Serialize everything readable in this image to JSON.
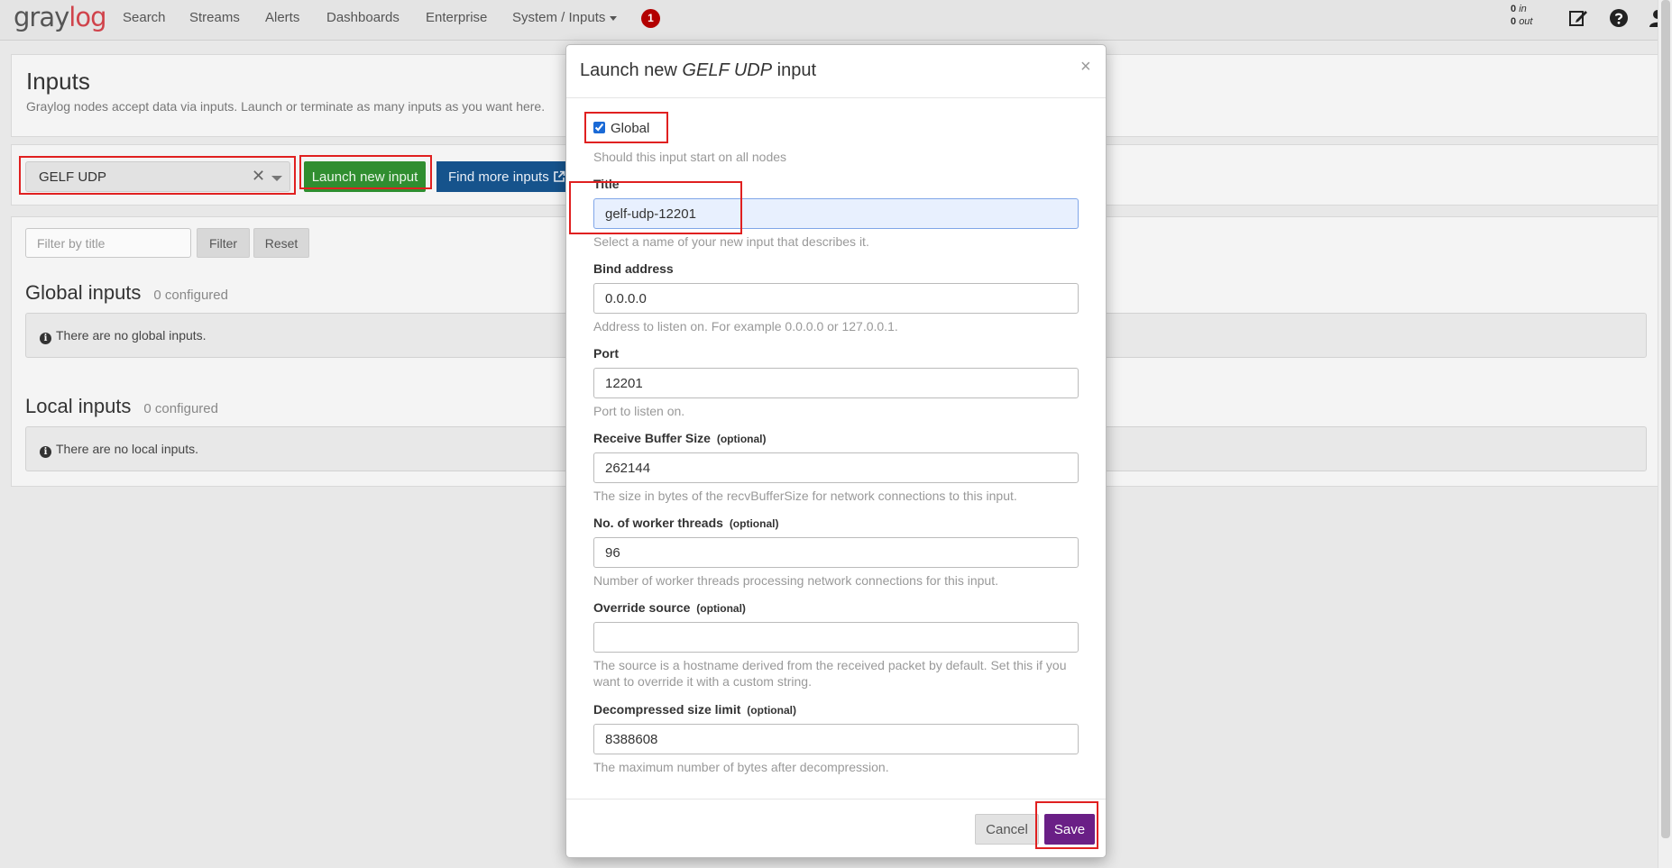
{
  "nav": {
    "logo_a": "gray",
    "logo_b": "log",
    "items": [
      "Search",
      "Streams",
      "Alerts",
      "Dashboards",
      "Enterprise",
      "System / Inputs"
    ],
    "notification_count": "1",
    "throughput_in_value": "0",
    "throughput_in_label": "in",
    "throughput_out_value": "0",
    "throughput_out_label": "out",
    "icons": [
      "edit-icon",
      "help-icon",
      "user-icon"
    ]
  },
  "page": {
    "title": "Inputs",
    "description": "Graylog nodes accept data via inputs. Launch or terminate as many inputs as you want here.",
    "input_type_value": "GELF UDP",
    "clear_glyph": "✕",
    "launch_button": "Launch new input",
    "find_more_button": "Find more inputs",
    "filter_placeholder": "Filter by title",
    "filter_button": "Filter",
    "reset_button": "Reset",
    "global_heading": "Global inputs",
    "global_count": "0 configured",
    "global_empty": "There are no global inputs.",
    "local_heading": "Local inputs",
    "local_count": "0 configured",
    "local_empty": "There are no local inputs.",
    "info_glyph": "i"
  },
  "modal": {
    "title_prefix": "Launch new ",
    "title_type": "GELF UDP",
    "title_suffix": " input",
    "close_glyph": "×",
    "global_label": "Global",
    "global_checked": true,
    "global_help": "Should this input start on all nodes",
    "fields": {
      "title": {
        "label": "Title",
        "value": "gelf-udp-12201",
        "help": "Select a name of your new input that describes it."
      },
      "bind_address": {
        "label": "Bind address",
        "value": "0.0.0.0",
        "help": "Address to listen on. For example 0.0.0.0 or 127.0.0.1."
      },
      "port": {
        "label": "Port",
        "value": "12201",
        "help": "Port to listen on."
      },
      "recv_buffer": {
        "label": "Receive Buffer Size",
        "optional": "(optional)",
        "value": "262144",
        "help": "The size in bytes of the recvBufferSize for network connections to this input."
      },
      "worker_threads": {
        "label": "No. of worker threads",
        "optional": "(optional)",
        "value": "96",
        "help": "Number of worker threads processing network connections for this input."
      },
      "override_source": {
        "label": "Override source",
        "optional": "(optional)",
        "value": "",
        "help": "The source is a hostname derived from the received packet by default. Set this if you want to override it with a custom string."
      },
      "decompress_limit": {
        "label": "Decompressed size limit",
        "optional": "(optional)",
        "value": "8388608",
        "help": "The maximum number of bytes after decompression."
      }
    },
    "cancel_button": "Cancel",
    "save_button": "Save"
  },
  "colors": {
    "launch_green": "#308e30",
    "find_more_blue": "#16538c",
    "save_purple": "#6a1f86",
    "badge_red": "#b30000",
    "highlight_red": "#e02020"
  }
}
